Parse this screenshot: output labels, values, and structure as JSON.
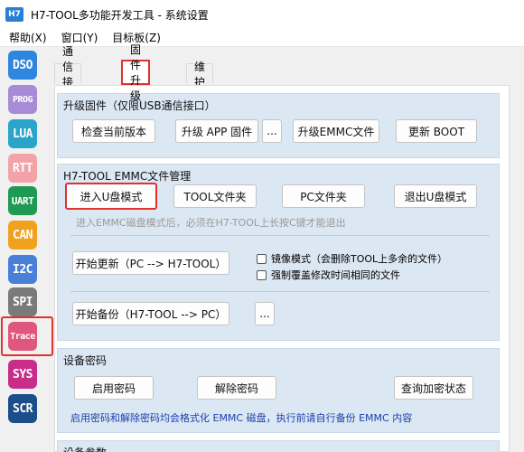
{
  "window": {
    "title": "H7-TOOL多功能开发工具 - 系统设置",
    "icon_text": "H7"
  },
  "menu": [
    "帮助(X)",
    "窗口(Y)",
    "目标板(Z)"
  ],
  "sidebar": [
    {
      "label": "DSO",
      "color": "#2e86de"
    },
    {
      "label": "PROG",
      "color": "#a78bd6"
    },
    {
      "label": "LUA",
      "color": "#2aa4c8"
    },
    {
      "label": "RTT",
      "color": "#f2a3a8"
    },
    {
      "label": "UART",
      "color": "#1f9a52"
    },
    {
      "label": "CAN",
      "color": "#f0a21e"
    },
    {
      "label": "I2C",
      "color": "#4a7fd8"
    },
    {
      "label": "SPI",
      "color": "#7a7a7a"
    },
    {
      "label": "Trace",
      "color": "#e0577e"
    },
    {
      "label": "SYS",
      "color": "#c92d8a"
    },
    {
      "label": "SCR",
      "color": "#1c4e8a"
    }
  ],
  "tabs": [
    "通信接口",
    "固件升级",
    "维护"
  ],
  "upgrade": {
    "title": "升级固件（仅限USB通信接口）",
    "check_version": "检查当前版本",
    "upgrade_app": "升级 APP 固件",
    "more": "...",
    "upgrade_emmc": "升级EMMC文件",
    "update_boot": "更新 BOOT"
  },
  "emmc": {
    "title": "H7-TOOL EMMC文件管理",
    "enter_udisk": "进入U盘模式",
    "tool_folder": "TOOL文件夹",
    "pc_folder": "PC文件夹",
    "exit_udisk": "退出U盘模式",
    "hint": "进入EMMC磁盘模式后，必须在H7-TOOL上长按C键才能退出",
    "start_update": "开始更新（PC --> H7-TOOL）",
    "mirror_mode": "镜像模式（会删除TOOL上多余的文件）",
    "force_overwrite": "强制覆盖修改时间相同的文件",
    "start_backup": "开始备份（H7-TOOL --> PC）",
    "backup_more": "..."
  },
  "password": {
    "title": "设备密码",
    "enable": "启用密码",
    "remove": "解除密码",
    "query": "查询加密状态",
    "warning": "启用密码和解除密码均会格式化 EMMC 磁盘，执行前请自行备份 EMMC 内容"
  },
  "params": {
    "title": "设备参数"
  }
}
